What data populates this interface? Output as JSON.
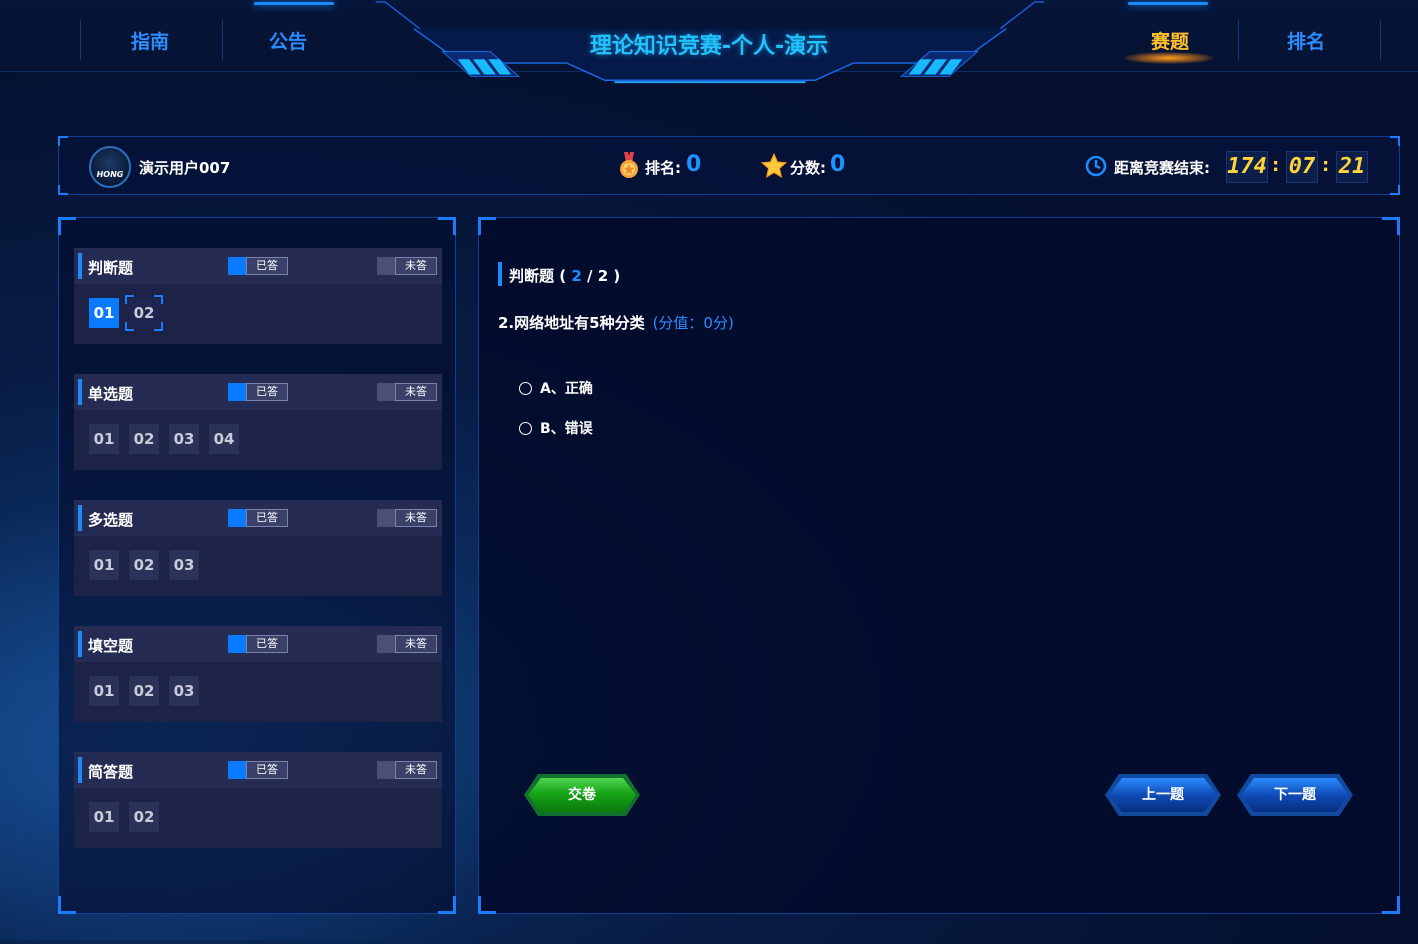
{
  "header": {
    "nav_left": [
      {
        "label": "指南"
      },
      {
        "label": "公告"
      }
    ],
    "title": "理论知识竞赛-个人-演示",
    "nav_right": [
      {
        "label": "赛题",
        "active": true
      },
      {
        "label": "排名",
        "active": false
      }
    ]
  },
  "user": {
    "name": "演示用户007",
    "avatar_text": "HONG",
    "rank_label": "排名:",
    "rank_value": "0",
    "score_label": "分数:",
    "score_value": "0",
    "countdown_label": "距离竞赛结束:",
    "countdown": {
      "hours": "174",
      "minutes": "07",
      "seconds": "21"
    },
    "icons": [
      "medal-icon",
      "star-icon",
      "clock-icon"
    ]
  },
  "legend": {
    "answered": "已答",
    "unanswered": "未答"
  },
  "sections": [
    {
      "title": "判断题",
      "questions": [
        "01",
        "02"
      ],
      "answered": [
        true,
        false
      ],
      "current": 1
    },
    {
      "title": "单选题",
      "questions": [
        "01",
        "02",
        "03",
        "04"
      ],
      "answered": [
        false,
        false,
        false,
        false
      ],
      "current": -1
    },
    {
      "title": "多选题",
      "questions": [
        "01",
        "02",
        "03"
      ],
      "answered": [
        false,
        false,
        false
      ],
      "current": -1
    },
    {
      "title": "填空题",
      "questions": [
        "01",
        "02",
        "03"
      ],
      "answered": [
        false,
        false,
        false
      ],
      "current": -1
    },
    {
      "title": "简答题",
      "questions": [
        "01",
        "02"
      ],
      "answered": [
        false,
        false
      ],
      "current": -1
    }
  ],
  "question": {
    "type": "判断题",
    "progress_open": " (",
    "progress_current": " 2",
    "progress_rest": " / 2 )",
    "text": "2.网络地址有5种分类",
    "score": "(分值：0分)",
    "options": [
      {
        "label": "A、正确"
      },
      {
        "label": "B、错误"
      }
    ]
  },
  "buttons": {
    "submit": "交卷",
    "prev": "上一题",
    "next": "下一题"
  },
  "colors": {
    "accent": "#1a8cff",
    "title": "#22c2ff",
    "active_nav": "#ffbf2e",
    "timer": "#ffd43a",
    "submit": "#17a417"
  }
}
